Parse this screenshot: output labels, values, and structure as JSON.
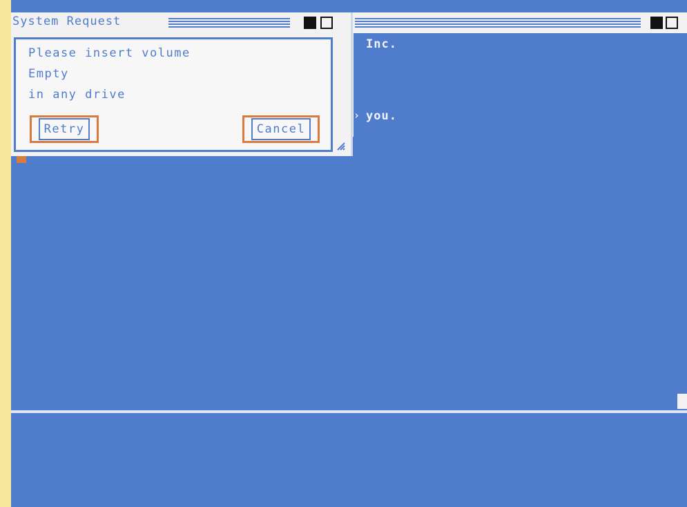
{
  "requester": {
    "title": "System Request",
    "lines": [
      "Please insert volume",
      "Empty",
      "in any drive"
    ],
    "retry_label": "Retry",
    "cancel_label": "Cancel"
  },
  "cli": {
    "line_1": "Inc.",
    "line_2": "you."
  },
  "colors": {
    "background": "#f7e79a",
    "screen": "#4f7ccd",
    "window": "#f2f2f2",
    "accent": "#d97a3e"
  }
}
